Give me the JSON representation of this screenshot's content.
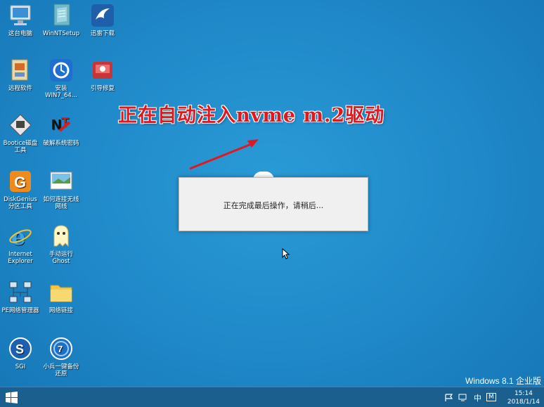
{
  "desktop": {
    "icons": [
      {
        "label": "这台电脑",
        "icon": "computer-icon"
      },
      {
        "label": "WinNTSetup",
        "icon": "winntsetup-icon"
      },
      {
        "label": "迅雷下载",
        "icon": "thunder-icon"
      },
      {
        "label": "远程软件",
        "icon": "remote-software-icon"
      },
      {
        "label": "安装\nWIN7_64...",
        "icon": "install-win7-icon"
      },
      {
        "label": "引导修复",
        "icon": "boot-repair-icon"
      },
      {
        "label": "Bootice磁盘\n工具",
        "icon": "bootice-icon"
      },
      {
        "label": "破解系统密码",
        "icon": "ntpwedit-icon"
      },
      {
        "label": "DiskGenius\n分区工具",
        "icon": "diskgenius-icon"
      },
      {
        "label": "如何连接无线\n网线",
        "icon": "wireless-icon"
      },
      {
        "label": "Internet\nExplorer",
        "icon": "internet-explorer-icon"
      },
      {
        "label": "手动运行\nGhost",
        "icon": "ghost-icon"
      },
      {
        "label": "PE网络管理器",
        "icon": "network-manager-icon"
      },
      {
        "label": "网络链接",
        "icon": "folder-icon"
      },
      {
        "label": "SGI",
        "icon": "sgi-icon"
      },
      {
        "label": "小兵一键备份\n还原",
        "icon": "backup-restore-icon"
      }
    ]
  },
  "annotation": {
    "text": "正在自动注入nvme m.2驱动",
    "color": "#e0181f"
  },
  "dialog": {
    "message": "正在完成最后操作，请稍后..."
  },
  "watermark": {
    "text": "Windows 8.1 企业版"
  },
  "taskbar": {
    "start_icon": "windows-logo-icon",
    "tray": {
      "network_icon": "network-icon",
      "ime": "中",
      "ime_mode": "M",
      "time": "15:14",
      "date": "2018/1/14"
    }
  },
  "colors": {
    "desktop": "#1f88c8",
    "taskbar": "#1b5f8f",
    "annotation": "#e0181f"
  }
}
